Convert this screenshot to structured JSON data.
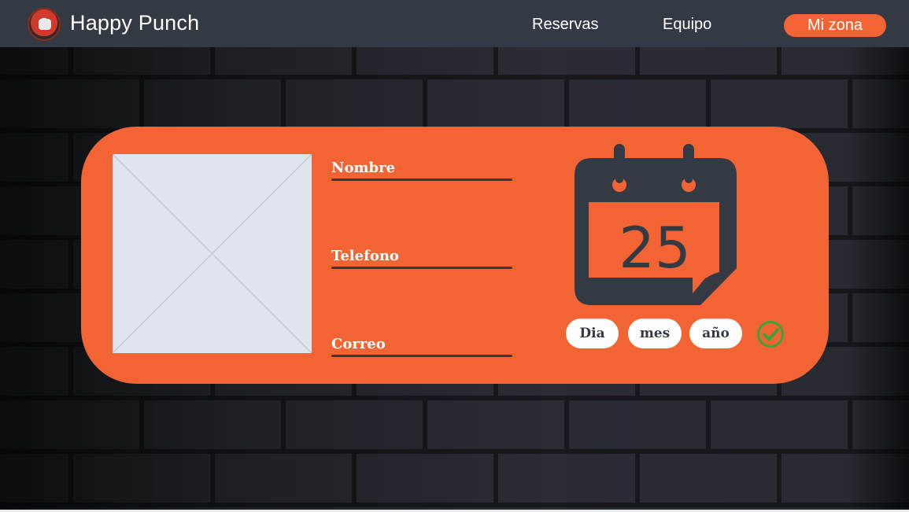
{
  "nav": {
    "brand": "Happy Punch",
    "links": [
      "Reservas",
      "Equipo"
    ],
    "cta": "Mi zona",
    "logo_icon": "happy-punch-logo"
  },
  "profile": {
    "photo_icon": "image-placeholder-icon",
    "fields": {
      "nombre": "Nombre",
      "telefono": "Telefono",
      "correo": "Correo"
    }
  },
  "calendar": {
    "icon": "calendar-icon",
    "day": "25",
    "date_parts": {
      "dia": "Dia",
      "mes": "mes",
      "ano": "año"
    },
    "confirm_icon": "check-circle-icon"
  },
  "colors": {
    "navbar": "#343a44",
    "accent": "#f26433",
    "photo_placeholder": "#e0e4ec",
    "check": "#3aa23a"
  }
}
